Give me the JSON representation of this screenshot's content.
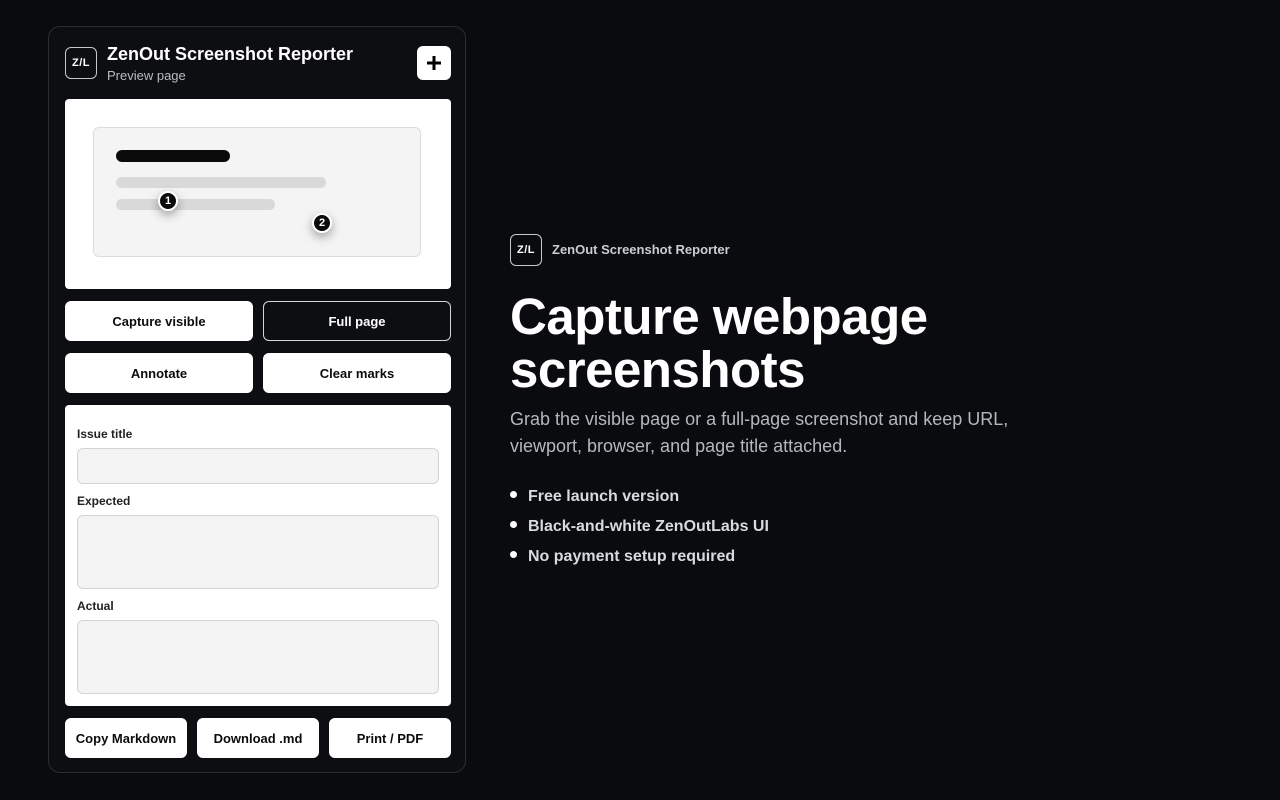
{
  "popup": {
    "logo": "Z/L",
    "title": "ZenOut Screenshot Reporter",
    "subtitle": "Preview page",
    "new_icon": "plus-icon"
  },
  "preview": {
    "markers": [
      "1",
      "2"
    ]
  },
  "actions": {
    "capture_visible": "Capture visible",
    "full_page": "Full page",
    "annotate": "Annotate",
    "clear_marks": "Clear marks"
  },
  "form": {
    "issue_title_label": "Issue title",
    "issue_title_value": "",
    "expected_label": "Expected",
    "expected_value": "",
    "actual_label": "Actual",
    "actual_value": ""
  },
  "export": {
    "copy_markdown": "Copy Markdown",
    "download_md": "Download .md",
    "print_pdf": "Print / PDF"
  },
  "hero": {
    "logo": "Z/L",
    "brand": "ZenOut Screenshot Reporter",
    "title": "Capture webpage screenshots",
    "description": "Grab the visible page or a full-page screenshot and keep URL, viewport, browser, and page title attached.",
    "features": [
      "Free launch version",
      "Black-and-white ZenOutLabs UI",
      "No payment setup required"
    ]
  },
  "colors": {
    "background": "#0a0b0e",
    "panel": "#0d0e12",
    "accent": "#ffffff"
  }
}
